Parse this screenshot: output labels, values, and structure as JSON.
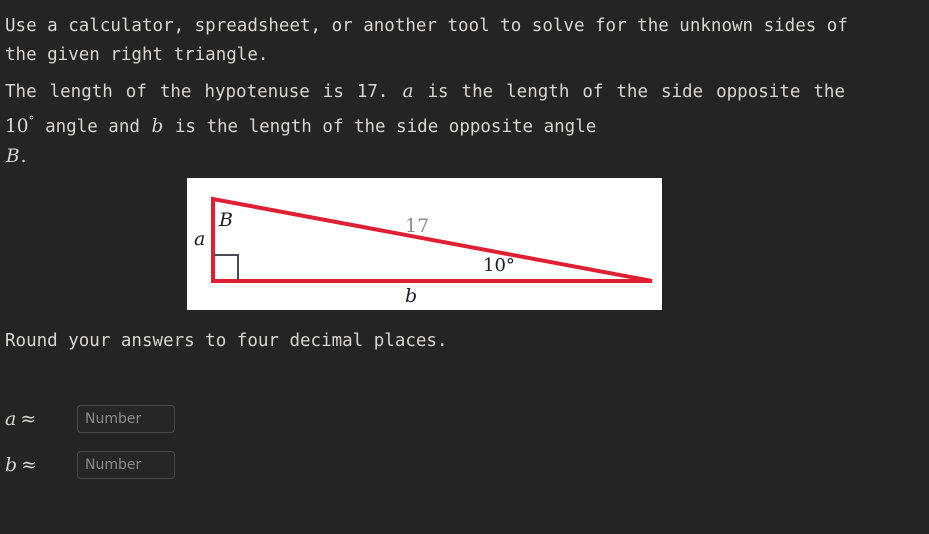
{
  "problem": {
    "intro": "Use a calculator, spreadsheet, or another tool to solve for the unknown sides of the given right triangle.",
    "given_part1": "The length of the hypotenuse is 17.",
    "given_var_a": "a",
    "given_part2": "is the length of the side opposite the",
    "given_angle_value": "10",
    "given_angle_degree": "°",
    "given_part3": "angle and",
    "given_var_b": "b",
    "given_part4": "is the length of the side opposite angle",
    "given_var_B": "B",
    "given_period": ".",
    "rounding_instruction": "Round your answers to four decimal places."
  },
  "figure": {
    "label_angle_vertex_B": "B",
    "label_side_a": "a",
    "label_side_b": "b",
    "label_hypotenuse": "17",
    "label_angle": "10°",
    "triangle_color": "#e01f33",
    "right_angle_marker_color": "#4a4a55",
    "background": "#ffffff",
    "hypotenuse_label_color": "#8c8c96"
  },
  "answers": [
    {
      "variable": "a",
      "approx_symbol": "≈",
      "value": "",
      "placeholder": "Number"
    },
    {
      "variable": "b",
      "approx_symbol": "≈",
      "value": "",
      "placeholder": "Number"
    }
  ],
  "theme": {
    "background": "#242424",
    "text_color": "#d7d6d4",
    "input_border": "#4a4a4a",
    "placeholder_color": "#8a8a8a"
  }
}
